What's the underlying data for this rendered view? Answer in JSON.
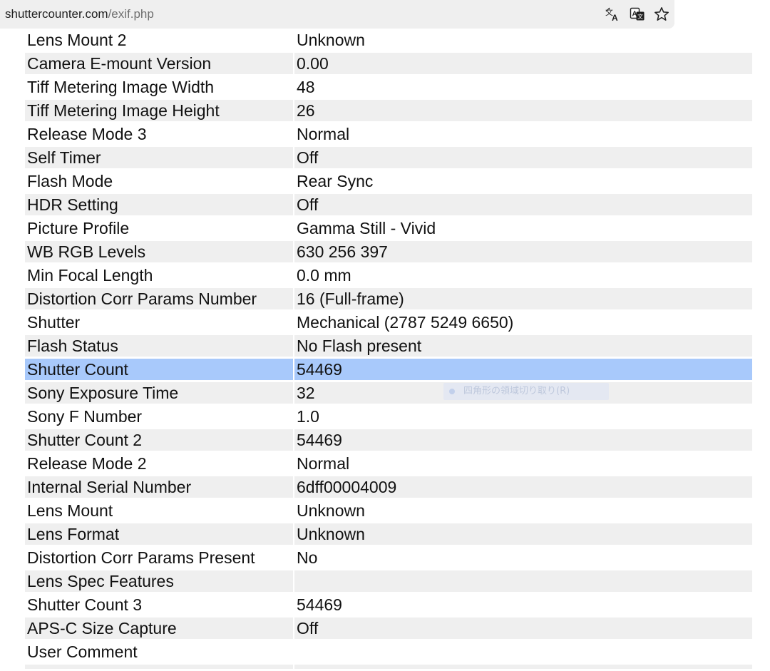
{
  "browser": {
    "url_host": "shuttercounter.com",
    "url_path": "/exif.php",
    "icons": [
      "translate-icon",
      "page-translate-icon",
      "star-icon"
    ],
    "icon_color": "#1f1f1f"
  },
  "exif": {
    "rows": [
      {
        "key": "Lens Mount 2",
        "value": "Unknown"
      },
      {
        "key": "Camera E-mount Version",
        "value": "0.00"
      },
      {
        "key": "Tiff Metering Image Width",
        "value": "48"
      },
      {
        "key": "Tiff Metering Image Height",
        "value": "26"
      },
      {
        "key": "Release Mode 3",
        "value": "Normal"
      },
      {
        "key": "Self Timer",
        "value": "Off"
      },
      {
        "key": "Flash Mode",
        "value": "Rear Sync"
      },
      {
        "key": "HDR Setting",
        "value": "Off"
      },
      {
        "key": "Picture Profile",
        "value": "Gamma Still - Vivid"
      },
      {
        "key": "WB RGB Levels",
        "value": "630 256 397"
      },
      {
        "key": "Min Focal Length",
        "value": "0.0 mm"
      },
      {
        "key": "Distortion Corr Params Number",
        "value": "16 (Full-frame)"
      },
      {
        "key": "Shutter",
        "value": "Mechanical (2787 5249 6650)"
      },
      {
        "key": "Flash Status",
        "value": "No Flash present"
      },
      {
        "key": "Shutter Count",
        "value": "54469"
      },
      {
        "key": "Sony Exposure Time",
        "value": "32"
      },
      {
        "key": "Sony F Number",
        "value": "1.0"
      },
      {
        "key": "Shutter Count 2",
        "value": "54469"
      },
      {
        "key": "Release Mode 2",
        "value": "Normal"
      },
      {
        "key": "Internal Serial Number",
        "value": "6dff00004009"
      },
      {
        "key": "Lens Mount",
        "value": "Unknown"
      },
      {
        "key": "Lens Format",
        "value": "Unknown"
      },
      {
        "key": "Distortion Corr Params Present",
        "value": "No"
      },
      {
        "key": "Lens Spec Features",
        "value": ""
      },
      {
        "key": "Shutter Count 3",
        "value": "54469"
      },
      {
        "key": "APS-C Size Capture",
        "value": "Off"
      },
      {
        "key": "User Comment",
        "value": ""
      }
    ],
    "selected_row": "Shutter Count",
    "colors": {
      "stripe": "#efefef",
      "selection": "#a8c9fb",
      "text": "#111111"
    }
  },
  "overlay": {
    "tooltip_text": "四角形の領域切り取り(R)"
  }
}
